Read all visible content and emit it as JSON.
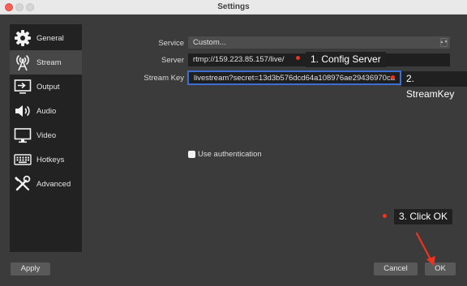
{
  "window": {
    "title": "Settings"
  },
  "sidebar": {
    "items": [
      {
        "label": "General",
        "icon": "gear-icon",
        "active": false
      },
      {
        "label": "Stream",
        "icon": "antenna-icon",
        "active": true
      },
      {
        "label": "Output",
        "icon": "output-icon",
        "active": false
      },
      {
        "label": "Audio",
        "icon": "speaker-icon",
        "active": false
      },
      {
        "label": "Video",
        "icon": "monitor-icon",
        "active": false
      },
      {
        "label": "Hotkeys",
        "icon": "keyboard-icon",
        "active": false
      },
      {
        "label": "Advanced",
        "icon": "tools-icon",
        "active": false
      }
    ]
  },
  "stream": {
    "service_label": "Service",
    "service_value": "Custom...",
    "server_label": "Server",
    "server_value": "rtmp://159.223.85.157/live/",
    "key_label": "Stream Key",
    "key_value": "livestream?secret=13d3b576dcd64a108976ae29436970ca",
    "auth_label": "Use authentication"
  },
  "buttons": {
    "apply": "Apply",
    "cancel": "Cancel",
    "ok": "OK"
  },
  "annotations": {
    "step1": "1. Config Server",
    "step2": "2. StreamKey",
    "step3": "3. Click OK"
  },
  "colors": {
    "accent": "#3b6fd4",
    "marker": "#f0331e",
    "background": "#3b3b3b",
    "sidebar": "#222222"
  }
}
